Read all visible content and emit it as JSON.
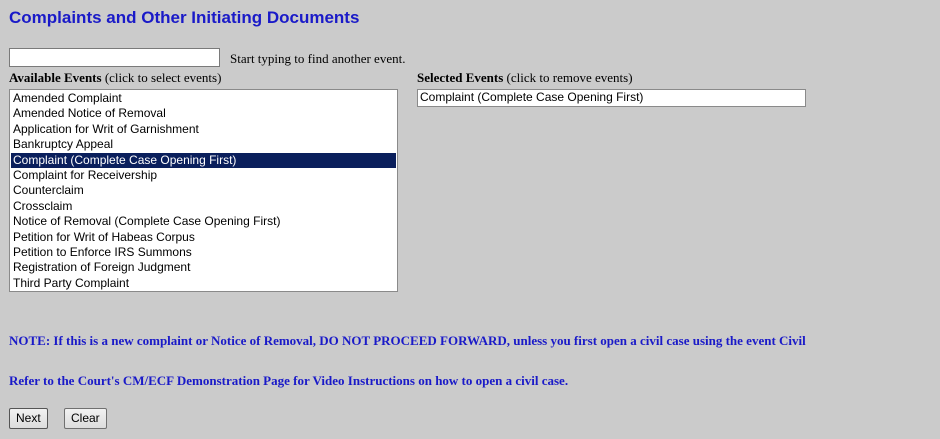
{
  "page": {
    "title": "Complaints and Other Initiating Documents"
  },
  "search": {
    "value": "",
    "hint": "Start typing to find another event."
  },
  "available": {
    "label_bold": "Available Events",
    "label_note": " (click to select events)",
    "items": [
      "Amended Complaint",
      "Amended Notice of Removal",
      "Application for Writ of Garnishment",
      "Bankruptcy Appeal",
      "Complaint (Complete Case Opening First)",
      "Complaint for Receivership",
      "Counterclaim",
      "Crossclaim",
      "Notice of Removal (Complete Case Opening First)",
      "Petition for Writ of Habeas Corpus",
      "Petition to Enforce IRS Summons",
      "Registration of Foreign Judgment",
      "Third Party Complaint"
    ],
    "selected_index": 4
  },
  "selected": {
    "label_bold": "Selected Events",
    "label_note": " (click to remove events)",
    "items": [
      "Complaint (Complete Case Opening First)"
    ]
  },
  "notes": {
    "note": "NOTE: If this is a new complaint or Notice of Removal, DO NOT PROCEED FORWARD, unless you first open a civil case using the event Civil",
    "refer": "Refer to the Court's CM/ECF Demonstration Page for Video Instructions on how to open a civil case."
  },
  "buttons": {
    "next": "Next",
    "clear": "Clear"
  },
  "colors": {
    "background": "#cbcbcb",
    "title": "#1a1ac8",
    "selection": "#0a1f5c"
  }
}
